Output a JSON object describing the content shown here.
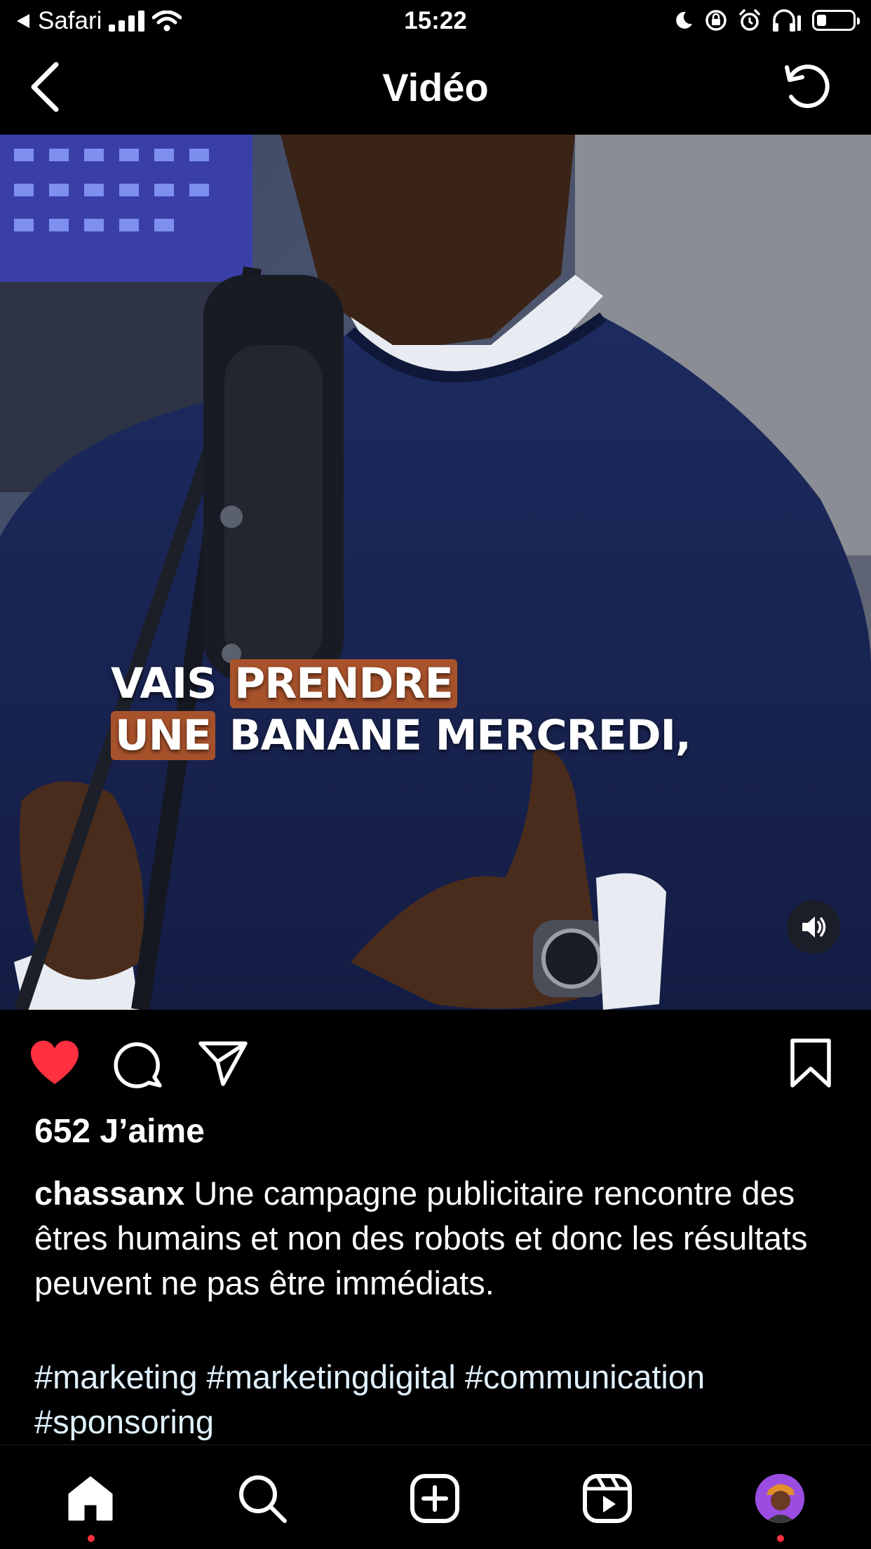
{
  "status_bar": {
    "back_app": "Safari",
    "time": "15:22",
    "battery_fraction": 0.25
  },
  "header": {
    "title": "Vidéo",
    "back_icon": "chevron-left-icon",
    "refresh_icon": "refresh-icon"
  },
  "video": {
    "caption_line1": {
      "word1": "VAIS",
      "word2": "PRENDRE"
    },
    "caption_line2": {
      "word1": "UNE",
      "word2": "BANANE MERCREDI,"
    },
    "mute_icon": "speaker-icon"
  },
  "actions": {
    "like_icon": "heart-filled-icon",
    "comment_icon": "comment-icon",
    "share_icon": "send-icon",
    "save_icon": "bookmark-icon",
    "like_color": "#ff3040"
  },
  "post": {
    "likes": "652 J’aime",
    "username": "chassanx",
    "caption": " Une campagne publicitaire rencontre des êtres humains et non des robots et donc les résultats peuvent ne pas être immédiats.",
    "hashtags": "#marketing #marketingdigital #communication #sponsoring"
  },
  "tab_bar": {
    "items": [
      "home-icon",
      "search-icon",
      "create-icon",
      "reels-icon",
      "profile-avatar"
    ],
    "badge_color": "#ff3040"
  }
}
